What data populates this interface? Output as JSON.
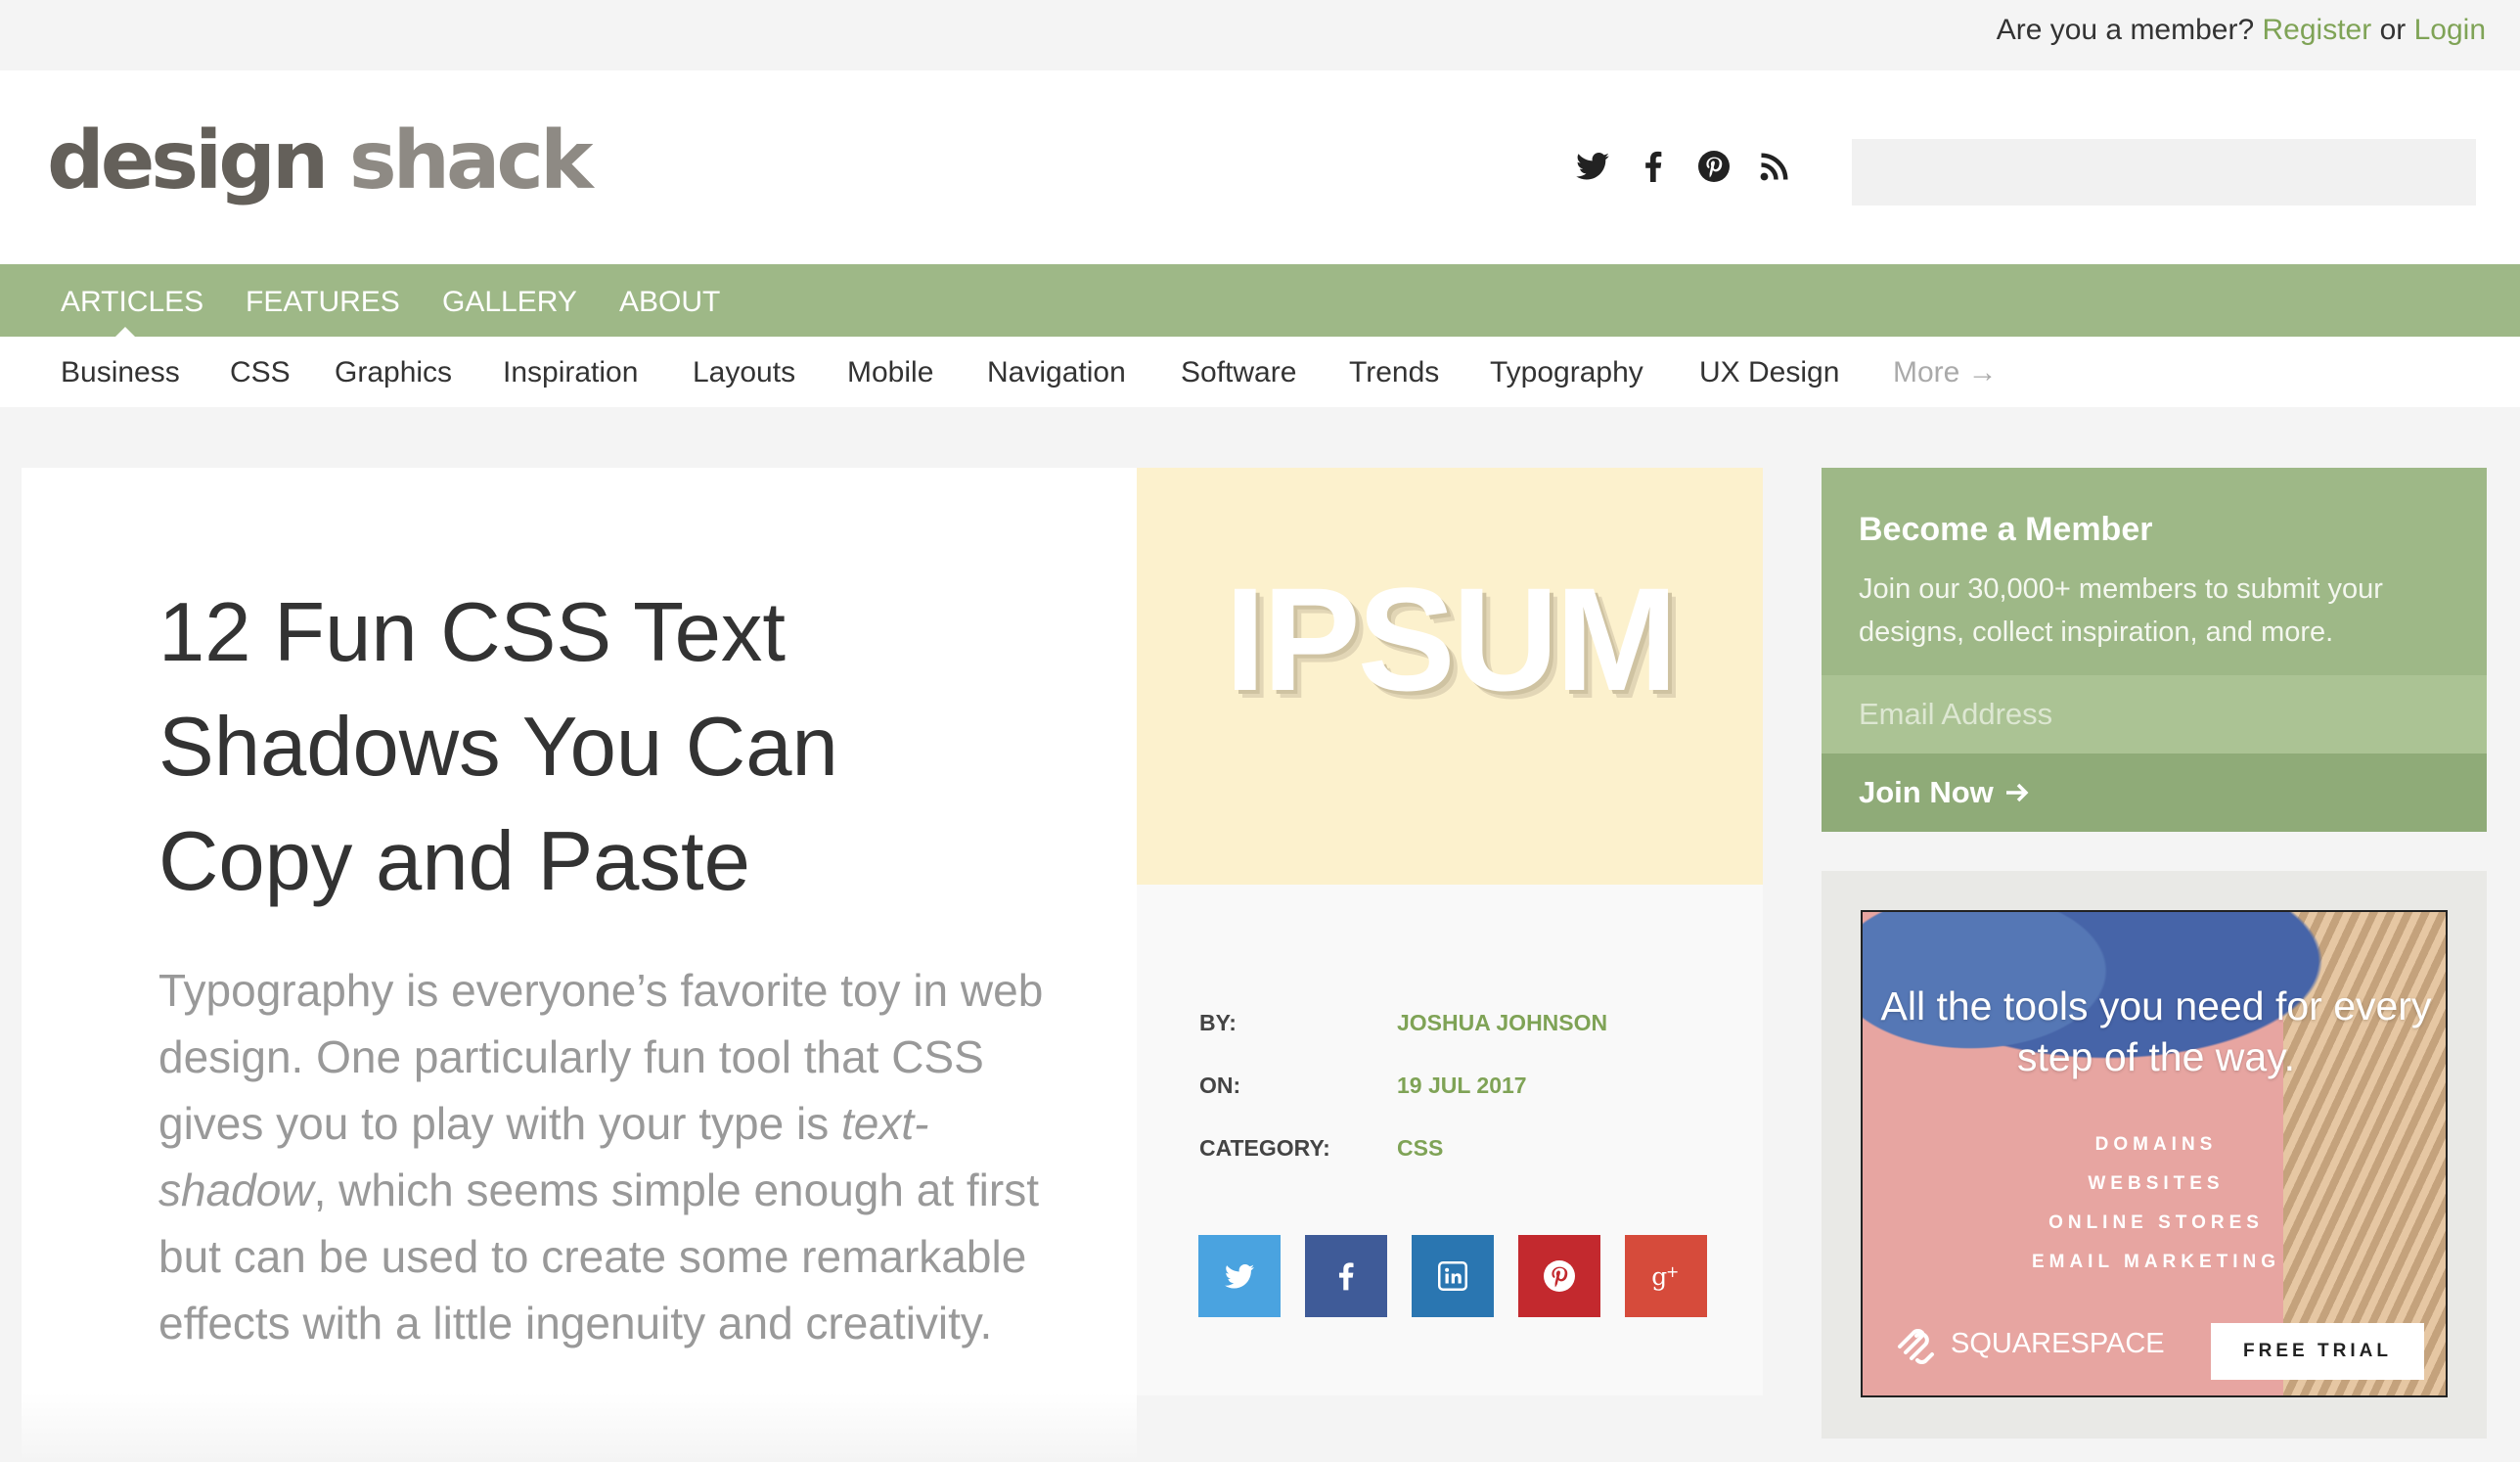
{
  "topbar": {
    "prompt": "Are you a member?",
    "register": "Register",
    "or": "or",
    "login": "Login"
  },
  "header": {
    "logo_word1": "design",
    "logo_word2": "shack",
    "social": [
      "twitter-icon",
      "facebook-icon",
      "pinterest-icon",
      "rss-icon"
    ],
    "search_placeholder": ""
  },
  "nav": {
    "items": [
      "ARTICLES",
      "FEATURES",
      "GALLERY",
      "ABOUT"
    ],
    "active": "ARTICLES"
  },
  "subnav": {
    "items": [
      "Business",
      "CSS",
      "Graphics",
      "Inspiration",
      "Layouts",
      "Mobile",
      "Navigation",
      "Software",
      "Trends",
      "Typography",
      "UX Design"
    ],
    "more": "More →"
  },
  "article": {
    "title": "12 Fun CSS Text Shadows You Can Copy and Paste",
    "excerpt_pre": "Typography is everyone’s favorite toy in web design. One particularly fun tool that CSS gives you to play with your type is ",
    "excerpt_em": "text-shadow",
    "excerpt_post": ", which seems simple enough at first but can be used to create some remarkable effects with a little ingenuity and creativity.",
    "feature_text": "IPSUM",
    "feature_bg": "#fcf1cd"
  },
  "meta": {
    "by_label": "BY:",
    "by_value": "JOSHUA JOHNSON",
    "on_label": "ON:",
    "on_value": "19 JUL 2017",
    "cat_label": "CATEGORY:",
    "cat_value": "CSS"
  },
  "share": [
    {
      "icon": "twitter-icon",
      "color": "#4aa3e0"
    },
    {
      "icon": "facebook-icon",
      "color": "#3f5b98"
    },
    {
      "icon": "linkedin-icon",
      "color": "#2a76b1"
    },
    {
      "icon": "pinterest-icon",
      "color": "#c3292e"
    },
    {
      "icon": "google-plus-icon",
      "color": "#d64b3b"
    }
  ],
  "member": {
    "heading": "Become a Member",
    "body": "Join our 30,000+ members to submit your designs, collect inspiration, and more.",
    "email_placeholder": "Email Address",
    "button": "Join Now",
    "accent": "#9eb887"
  },
  "ad": {
    "headline": "All the tools you need for every step of the way.",
    "lines": [
      "DOMAINS",
      "WEBSITES",
      "ONLINE STORES",
      "EMAIL MARKETING"
    ],
    "brand": "SQUARESPACE",
    "cta": "FREE TRIAL"
  }
}
